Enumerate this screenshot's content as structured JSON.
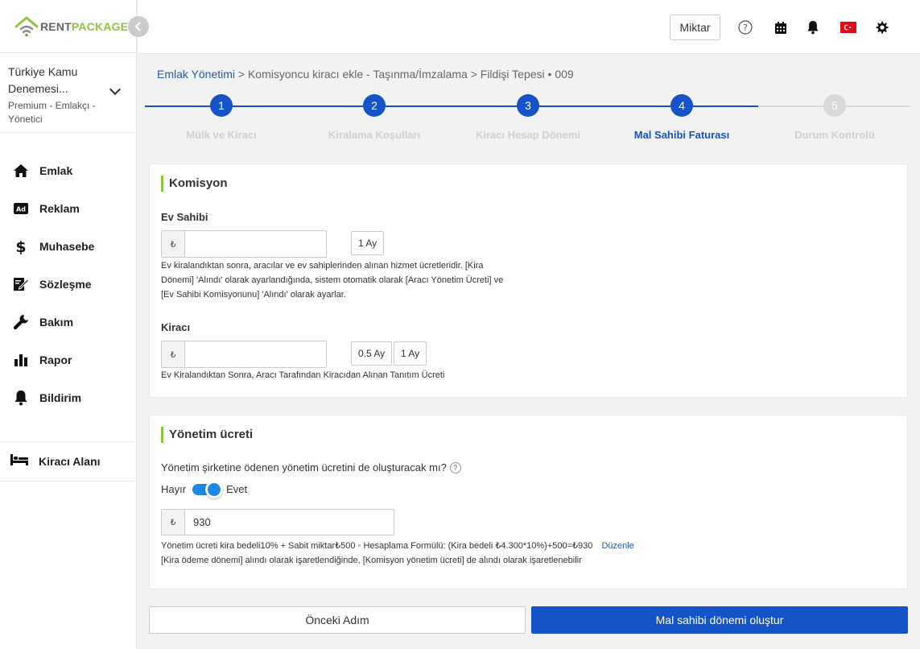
{
  "brand": {
    "part1": "RENT",
    "part2": "PACKAGE",
    "green": "#8dc63f",
    "gray": "#666666"
  },
  "account": {
    "name": "Türkiye Kamu Denemesi...",
    "role": "Premium - Emlakçı - Yönetici"
  },
  "sidebar": {
    "items": [
      {
        "label": "Emlak",
        "icon": "home-icon"
      },
      {
        "label": "Reklam",
        "icon": "ad-icon"
      },
      {
        "label": "Muhasebe",
        "icon": "dollar-icon"
      },
      {
        "label": "Sözleşme",
        "icon": "contract-icon"
      },
      {
        "label": "Bakım",
        "icon": "wrench-icon"
      },
      {
        "label": "Rapor",
        "icon": "bar-chart-icon"
      },
      {
        "label": "Bildirim",
        "icon": "bell-icon"
      }
    ],
    "tenant_area": {
      "label": "Kiracı Alanı",
      "icon": "bed-icon"
    }
  },
  "topbar": {
    "miktar_label": "Miktar",
    "icons": [
      "help-icon",
      "calendar-icon",
      "bell-icon",
      "turkey-flag-icon",
      "gear-icon"
    ]
  },
  "breadcrumb": {
    "home": "Emlak Yönetimi",
    "rest": " > Komisyoncu kiracı ekle - Taşınma/İmzalama > Fildişi Tepesi • 009"
  },
  "stepper": {
    "current": 4,
    "steps": [
      {
        "num": "1",
        "label": "Mülk ve Kiracı"
      },
      {
        "num": "2",
        "label": "Kiralama Koşulları"
      },
      {
        "num": "3",
        "label": "Kiracı Hesap Dönemi"
      },
      {
        "num": "4",
        "label": "Mal Sahibi Faturası"
      },
      {
        "num": "5",
        "label": "Durum Kontrolü"
      }
    ]
  },
  "commission": {
    "title": "Komisyon",
    "currency": "₺",
    "landlord": {
      "label": "Ev Sahibi",
      "value": "",
      "btn": "1 Ay",
      "help": "Ev kiralandıktan sonra, aracılar ve ev sahiplerinden alınan hizmet ücretleridir. [Kira Dönemi] 'Alındı' olarak ayarlandığında, sistem otomatik olarak [Aracı Yönetim Ücreti] ve [Ev Sahibi Komisyonunu] 'Alındı' olarak ayarlar."
    },
    "tenant": {
      "label": "Kiracı",
      "value": "",
      "btn1": "0.5 Ay",
      "btn2": "1 Ay",
      "help": "Ev Kiralandıktan Sonra, Aracı Tarafından Kiracıdan Alınan Tanıtım Ücreti"
    }
  },
  "management": {
    "title": "Yönetim ücreti",
    "question": "Yönetim şirketine ödenen yönetim ücretini de oluşturacak mı?",
    "q_mark": "?",
    "no": "Hayır",
    "yes": "Evet",
    "toggle_on": true,
    "currency": "₺",
    "value": "930",
    "formula": "Yönetim ücreti kira bedeli10% + Sabit miktar₺500 ◦ Hesaplama Formülü: (Kira bedeli ₺4.300*10%)+500=₺930",
    "edit": "Düzenle",
    "note": "[Kira ödeme dönemi] alındı olarak işaretlendiğinde, [Komisyon yönetim ücreti] de alındı olarak işaretlenebilir"
  },
  "footer": {
    "prev": "Önceki Adım",
    "next": "Mal sahibi dönemi oluştur"
  },
  "colors": {
    "primary": "#1453c8",
    "accent": "#8dc63f",
    "toggle": "#1e88e5"
  }
}
